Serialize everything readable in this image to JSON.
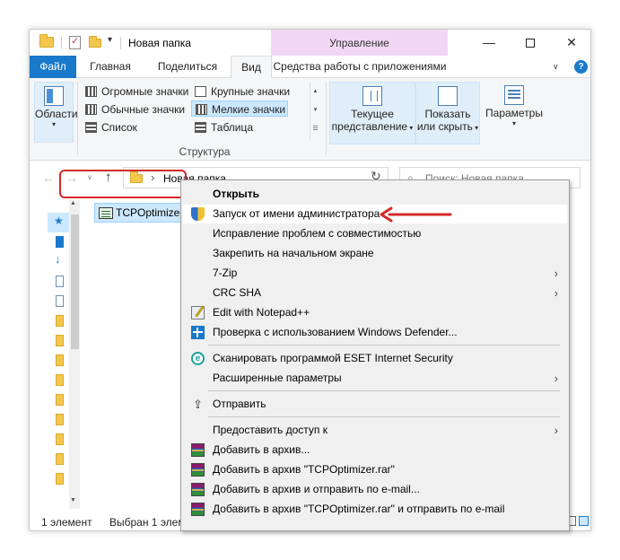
{
  "window": {
    "title": "Новая папка",
    "context_tab_header": "Управление",
    "buttons": {
      "minimize": "—",
      "maximize": "",
      "close": "✕"
    }
  },
  "ribbon_tabs": {
    "file": "Файл",
    "home": "Главная",
    "share": "Поделиться",
    "view": "Вид",
    "app_tools": "Средства работы с приложениями"
  },
  "ribbon": {
    "panes_label": "Области",
    "layout_group": {
      "label": "Структура",
      "items": [
        {
          "label": "Огромные значки"
        },
        {
          "label": "Крупные значки"
        },
        {
          "label": "Обычные значки"
        },
        {
          "label": "Мелкие значки"
        },
        {
          "label": "Список"
        },
        {
          "label": "Таблица"
        }
      ]
    },
    "current_view": {
      "line1": "Текущее",
      "line2": "представление"
    },
    "show_hide": {
      "line1": "Показать",
      "line2": "или скрыть"
    },
    "options": {
      "label": "Параметры"
    }
  },
  "address": {
    "path": "Новая папка",
    "search_placeholder": "Поиск: Новая папка"
  },
  "content": {
    "file_name": "TCPOptimizer"
  },
  "status": {
    "count": "1 элемент",
    "selected": "Выбран 1 элем"
  },
  "context_menu": {
    "items": [
      {
        "label": "Открыть"
      },
      {
        "label": "Запуск от имени администратора"
      },
      {
        "label": "Исправление проблем с совместимостью"
      },
      {
        "label": "Закрепить на начальном экране"
      },
      {
        "label": "7-Zip"
      },
      {
        "label": "CRC SHA"
      },
      {
        "label": "Edit with Notepad++"
      },
      {
        "label": "Проверка с использованием Windows Defender..."
      },
      {
        "label": "Сканировать программой ESET Internet Security"
      },
      {
        "label": "Расширенные параметры"
      },
      {
        "label": "Отправить"
      },
      {
        "label": "Предоставить доступ к"
      },
      {
        "label": "Добавить в архив..."
      },
      {
        "label": "Добавить в архив \"TCPOptimizer.rar\""
      },
      {
        "label": "Добавить в архив и отправить по e-mail..."
      },
      {
        "label": "Добавить в архив \"TCPOptimizer.rar\" и отправить по e-mail"
      }
    ]
  },
  "colors": {
    "accent": "#1979ca",
    "context_tab": "#f2d7f5",
    "selection": "#cce8ff",
    "annotation_red": "#d72828"
  }
}
